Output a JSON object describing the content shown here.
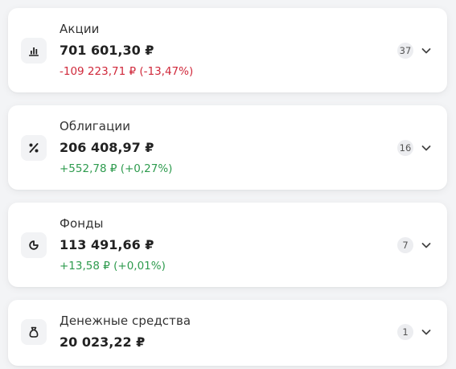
{
  "colors": {
    "negative": "#d0293b",
    "positive": "#2e9b4e"
  },
  "assets": [
    {
      "title": "Акции",
      "amount": "701 601,30 ₽",
      "change": "-109 223,71 ₽ (-13,47%)",
      "change_type": "negative",
      "count": "37",
      "icon": "bar-chart-icon"
    },
    {
      "title": "Облигации",
      "amount": "206 408,97 ₽",
      "change": "+552,78 ₽ (+0,27%)",
      "change_type": "positive",
      "count": "16",
      "icon": "percent-icon"
    },
    {
      "title": "Фонды",
      "amount": "113 491,66 ₽",
      "change": "+13,58 ₽ (+0,01%)",
      "change_type": "positive",
      "count": "7",
      "icon": "pie-chart-icon"
    },
    {
      "title": "Денежные средства",
      "amount": "20 023,22 ₽",
      "count": "1",
      "icon": "money-bag-icon"
    }
  ]
}
